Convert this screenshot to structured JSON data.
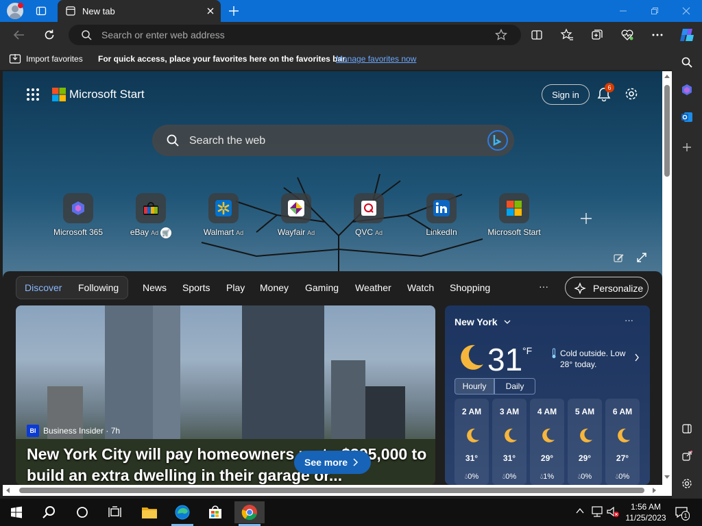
{
  "browser": {
    "tab_title": "New tab",
    "address_placeholder": "Search or enter web address"
  },
  "favorites_bar": {
    "import_label": "Import favorites",
    "hint": "For quick access, place your favorites here on the favorites bar.",
    "manage_link": "Manage favorites now"
  },
  "ms_start": {
    "brand": "Microsoft Start",
    "sign_in": "Sign in",
    "notification_count": "6",
    "search_placeholder": "Search the web"
  },
  "quick_links": [
    {
      "name": "Microsoft 365",
      "ad": ""
    },
    {
      "name": "eBay",
      "ad": "Ad"
    },
    {
      "name": "Walmart",
      "ad": "Ad"
    },
    {
      "name": "Wayfair",
      "ad": "Ad"
    },
    {
      "name": "QVC",
      "ad": "Ad"
    },
    {
      "name": "LinkedIn",
      "ad": ""
    },
    {
      "name": "Microsoft Start",
      "ad": ""
    }
  ],
  "feed_nav": {
    "discover": "Discover",
    "following": "Following",
    "items": [
      "News",
      "Sports",
      "Play",
      "Money",
      "Gaming",
      "Weather",
      "Watch",
      "Shopping"
    ],
    "more": "···",
    "personalize": "Personalize"
  },
  "news_card": {
    "source_badge": "BI",
    "source": "Business Insider · 7h",
    "headline": "New York City will pay homeowners up to $395,000 to build an extra dwelling in their garage or...",
    "see_more": "See more"
  },
  "weather": {
    "city": "New York",
    "temp": "31",
    "unit": "°F",
    "description": "Cold outside. Low 28° today.",
    "tab_hourly": "Hourly",
    "tab_daily": "Daily",
    "more": "···",
    "hours": [
      {
        "time": "2 AM",
        "temp": "31°",
        "precip": "0%"
      },
      {
        "time": "3 AM",
        "temp": "31°",
        "precip": "0%"
      },
      {
        "time": "4 AM",
        "temp": "29°",
        "precip": "1%"
      },
      {
        "time": "5 AM",
        "temp": "29°",
        "precip": "0%"
      },
      {
        "time": "6 AM",
        "temp": "27°",
        "precip": "0%"
      }
    ]
  },
  "taskbar": {
    "time": "1:56 AM",
    "date": "11/25/2023",
    "notification_count": "1"
  }
}
